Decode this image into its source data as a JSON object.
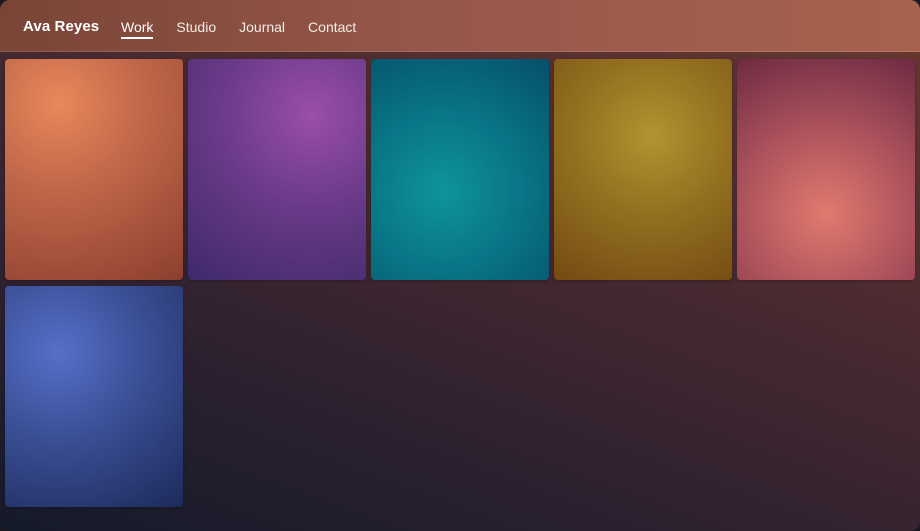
{
  "header": {
    "brand": "Ava Reyes",
    "nav": [
      {
        "label": "Work",
        "active": true
      },
      {
        "label": "Studio",
        "active": false
      },
      {
        "label": "Journal",
        "active": false
      },
      {
        "label": "Contact",
        "active": false
      }
    ]
  },
  "gallery": {
    "cards": [
      {
        "name": "work-card-1",
        "color": "#c0674a"
      },
      {
        "name": "work-card-2",
        "color": "#6a3a88"
      },
      {
        "name": "work-card-3",
        "color": "#087686"
      },
      {
        "name": "work-card-4",
        "color": "#937020"
      },
      {
        "name": "work-card-5",
        "color": "#b0555e"
      },
      {
        "name": "work-card-6",
        "color": "#3a4e94"
      }
    ]
  }
}
